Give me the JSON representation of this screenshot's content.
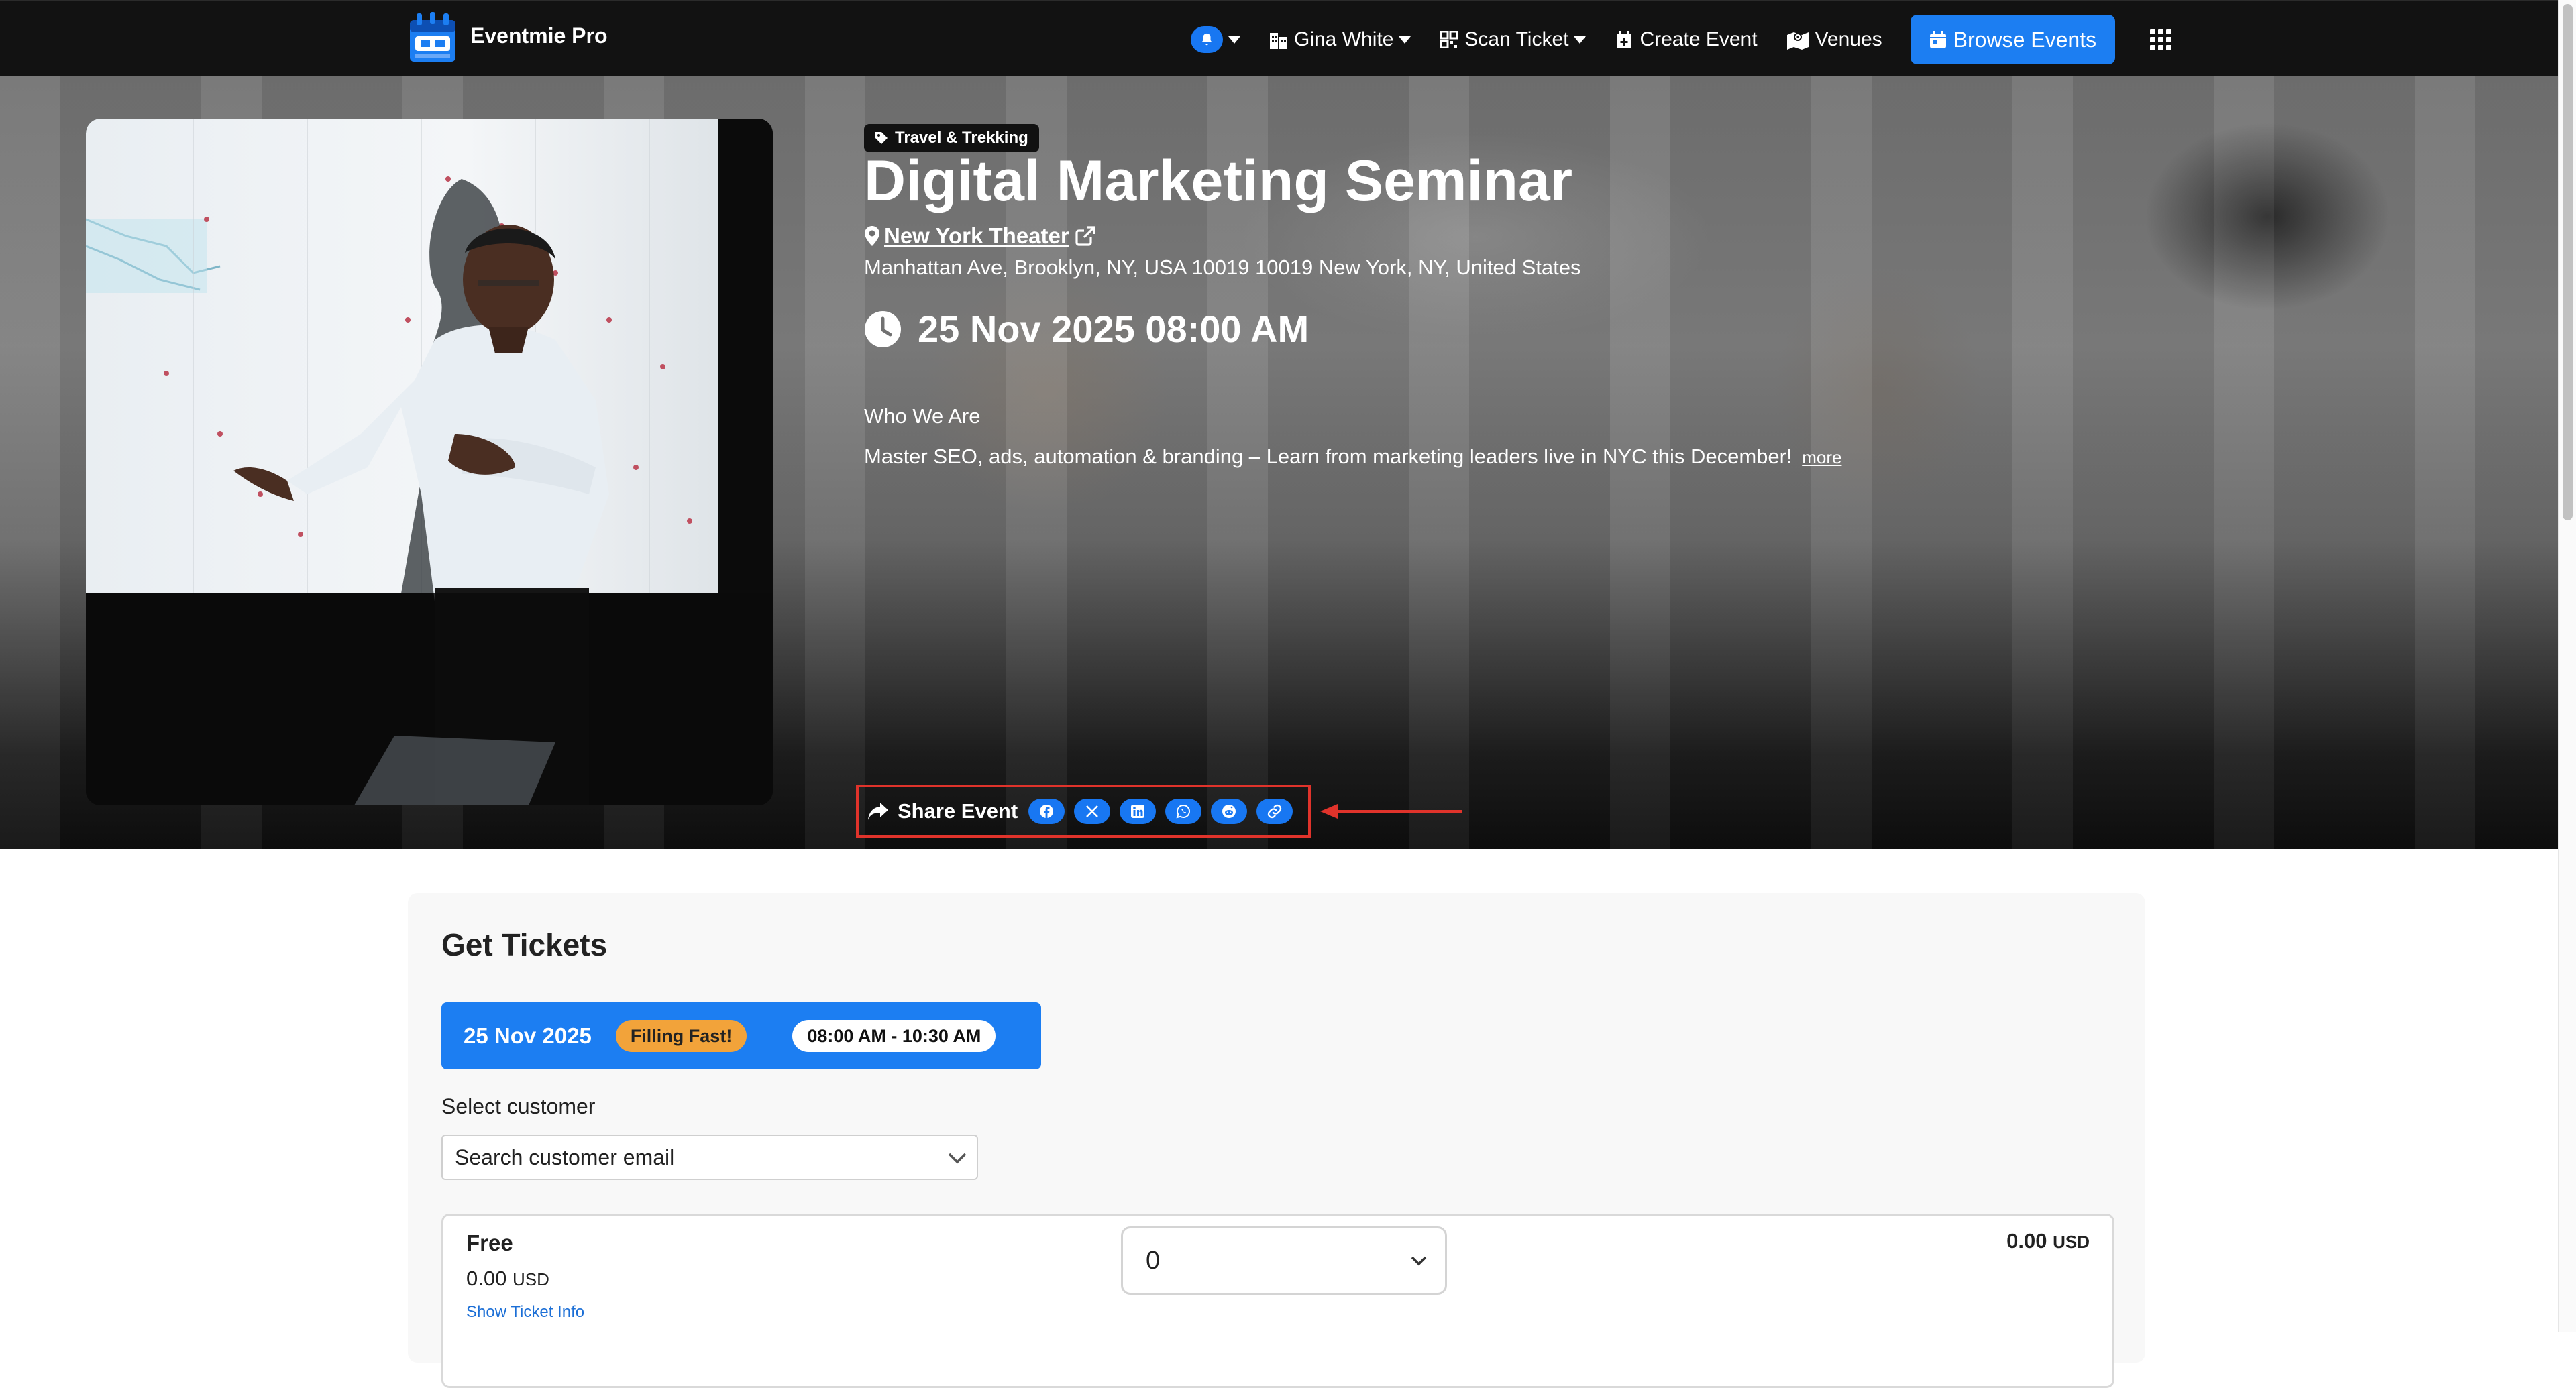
{
  "navbar": {
    "brand": "Eventmie Pro",
    "user_name": "Gina White",
    "scan_ticket": "Scan Ticket",
    "create_event": "Create Event",
    "venues": "Venues",
    "browse_events": "Browse Events",
    "icons": [
      "bell-icon",
      "building-icon",
      "qrcode-icon",
      "calendar-plus-icon",
      "map-icon",
      "calendar-icon",
      "grid-icon"
    ]
  },
  "event": {
    "category": "Travel & Trekking",
    "title": "Digital Marketing Seminar",
    "venue": "New York Theater",
    "address": "Manhattan Ave, Brooklyn, NY, USA 10019 10019 New York, NY, United States",
    "datetime": "25 Nov 2025 08:00 AM",
    "about_heading": "Who We Are",
    "about_text": "Master SEO, ads, automation & branding – Learn from marketing leaders live in NYC this December!",
    "more_label": "more"
  },
  "share": {
    "label": "Share Event",
    "buttons": [
      "facebook-icon",
      "x-icon",
      "linkedin-icon",
      "whatsapp-icon",
      "reddit-icon",
      "link-icon"
    ]
  },
  "tickets": {
    "title": "Get Tickets",
    "date": "25 Nov 2025",
    "status_badge": "Filling Fast!",
    "time_range": "08:00 AM - 10:30 AM",
    "select_customer_label": "Select customer",
    "customer_placeholder": "Search customer email",
    "items": [
      {
        "name": "Free",
        "price": "0.00",
        "currency": "USD",
        "info_link": "Show Ticket Info",
        "quantity": "0",
        "total": "0.00",
        "total_currency": "USD"
      }
    ]
  },
  "colors": {
    "navbar_bg": "#121212",
    "accent": "#1c7ef2",
    "badge_orange": "#f2a33a",
    "annotation_red": "#e0332b"
  }
}
